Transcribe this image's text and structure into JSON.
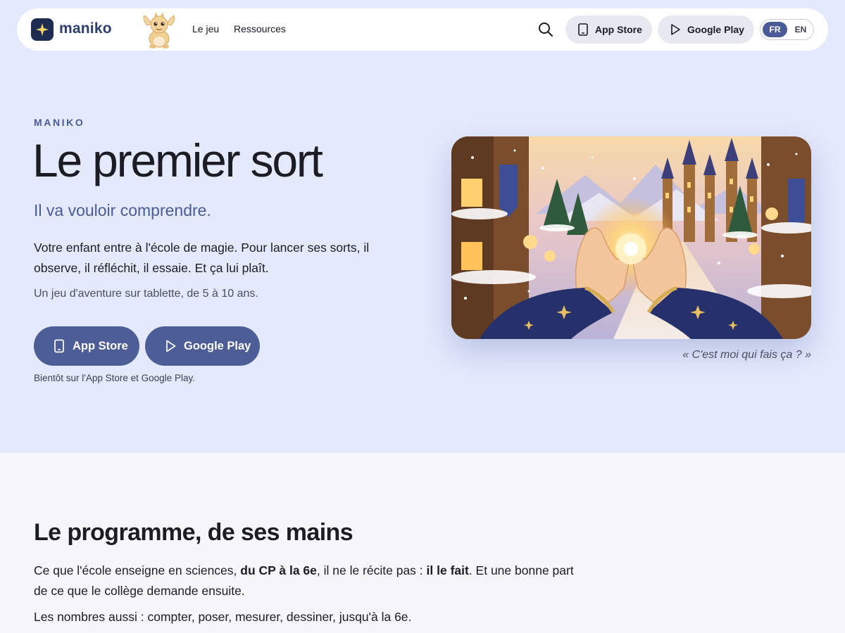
{
  "nav": {
    "brand": "maniko",
    "links": [
      {
        "label": "Le jeu"
      },
      {
        "label": "Ressources"
      }
    ],
    "app_store_label": "App Store",
    "google_play_label": "Google Play",
    "lang_options": [
      "FR",
      "EN"
    ],
    "lang_selected": "FR"
  },
  "hero": {
    "eyebrow": "MANIKO",
    "title": "Le premier sort",
    "subtitle": "Il va vouloir comprendre.",
    "body": "Votre enfant entre à l'école de magie. Pour lancer ses sorts, il observe, il réfléchit, il essaie. Et ça lui plaît.",
    "tagline": "Un jeu d'aventure sur tablette, de 5 à 10 ans.",
    "cta_app_store": "App Store",
    "cta_google_play": "Google Play",
    "availability": "Bientôt sur l'App Store et Google Play.",
    "image_caption": "« C'est moi qui fais ça ? »"
  },
  "program": {
    "title": "Le programme, de ses mains",
    "p1_a": "Ce que l'école enseigne en sciences, ",
    "p1_bold1": "du CP à la 6e",
    "p1_b": ", il ne le récite pas : ",
    "p1_bold2": "il le fait",
    "p1_c": ". Et une bonne part de ce que le collège demande ensuite.",
    "p2": "Les nombres aussi : compter, poser, mesurer, dessiner, jusqu'à la 6e."
  },
  "icons": {
    "logo": "sparkle-icon",
    "mascot": "dragon-mascot",
    "search": "search-icon",
    "tablet": "tablet-icon",
    "play": "play-icon"
  },
  "colors": {
    "accent": "#4a5b97",
    "cta": "#4d5d95",
    "hero_bg": "#e4e9fc",
    "logo_bg": "#1e2c52"
  }
}
